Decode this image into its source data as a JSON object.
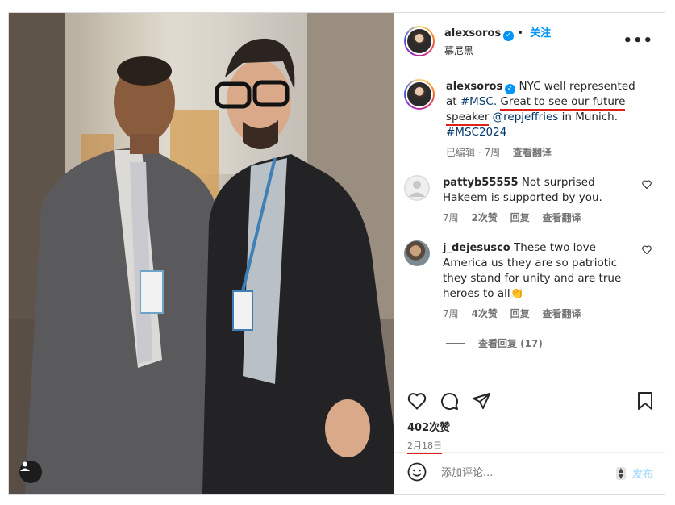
{
  "post": {
    "username": "alexsoros",
    "follow_label": "关注",
    "location": "慕尼黑",
    "more_label": "•••"
  },
  "caption": {
    "username": "alexsoros",
    "text_plain_1": "NYC well represented at",
    "hashtag_1": "#MSC.",
    "underlined_text": "Great to see our future speaker",
    "mention": "@repjeffries",
    "text_plain_2": "in Munich.",
    "hashtag_2": "#MSC2024",
    "edited_label": "已编辑 · 7周",
    "translate_label": "查看翻译"
  },
  "comments": [
    {
      "username": "pattyb55555",
      "text": "Not surprised Hakeem is supported by you.",
      "time": "7周",
      "likes": "2次赞",
      "reply_label": "回复",
      "translate_label": "查看翻译"
    },
    {
      "username": "j_dejesusco",
      "text": "These two love America us they are so patriotic they stand for unity and are true heroes to all👏",
      "time": "7周",
      "likes": "4次赞",
      "reply_label": "回复",
      "translate_label": "查看翻译"
    }
  ],
  "view_replies_label": "查看回复 (17)",
  "likes_label": "402次赞",
  "date_label": "2月18日",
  "add_comment_placeholder": "添加评论...",
  "post_button_label": "发布",
  "colors": {
    "link_blue": "#0095f6",
    "hashtag_blue": "#00376b",
    "annotation_red": "#e0201b"
  }
}
